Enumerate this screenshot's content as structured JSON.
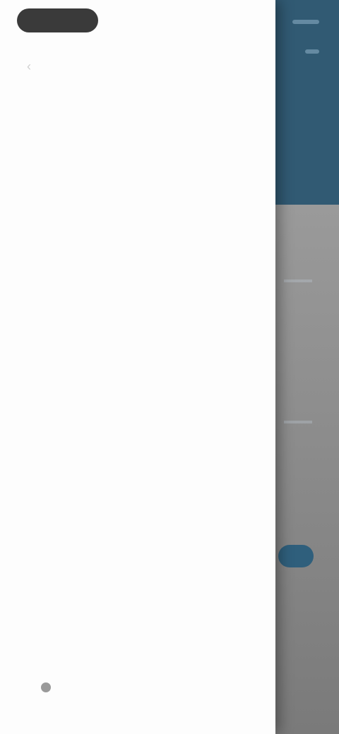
{
  "drawer": {
    "header": {
      "title": "",
      "back_icon": "‹"
    },
    "menu_items": [
      {
        "label": ""
      },
      {
        "label": ""
      },
      {
        "label": ""
      },
      {
        "label": ""
      },
      {
        "label": ""
      },
      {
        "label": ""
      },
      {
        "label": ""
      },
      {
        "label": ""
      },
      {
        "label": ""
      },
      {
        "label": ""
      },
      {
        "label": ""
      },
      {
        "label": ""
      },
      {
        "label": ""
      }
    ],
    "footer_note": ""
  },
  "colors": {
    "drawer_bg": "#fdfdfd",
    "hero_bg": "#315a73",
    "overlay": "#7f7f7f"
  }
}
